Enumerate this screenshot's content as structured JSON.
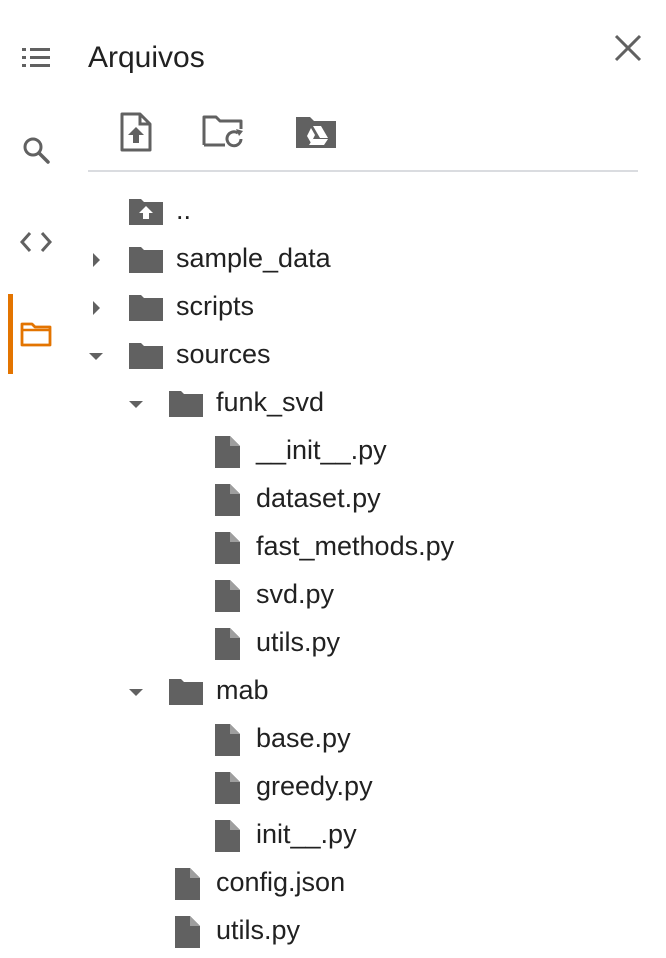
{
  "side_rail": {
    "items": [
      {
        "icon": "table-of-contents-icon"
      },
      {
        "icon": "search-icon"
      },
      {
        "icon": "code-snippets-icon"
      },
      {
        "icon": "folder-icon",
        "active": true
      }
    ],
    "accent_color": "#e37400"
  },
  "panel": {
    "title": "Arquivos",
    "toolbar": [
      {
        "icon": "upload-file-icon"
      },
      {
        "icon": "refresh-folder-icon"
      },
      {
        "icon": "mount-drive-icon"
      }
    ]
  },
  "tree": [
    {
      "label": "..",
      "type": "parent",
      "depth": 0
    },
    {
      "label": "sample_data",
      "type": "folder",
      "depth": 0,
      "expanded": false
    },
    {
      "label": "scripts",
      "type": "folder",
      "depth": 0,
      "expanded": false
    },
    {
      "label": "sources",
      "type": "folder",
      "depth": 0,
      "expanded": true
    },
    {
      "label": "funk_svd",
      "type": "folder",
      "depth": 1,
      "expanded": true
    },
    {
      "label": "__init__.py",
      "type": "file",
      "depth": 2
    },
    {
      "label": "dataset.py",
      "type": "file",
      "depth": 2
    },
    {
      "label": "fast_methods.py",
      "type": "file",
      "depth": 2
    },
    {
      "label": "svd.py",
      "type": "file",
      "depth": 2
    },
    {
      "label": "utils.py",
      "type": "file",
      "depth": 2
    },
    {
      "label": "mab",
      "type": "folder",
      "depth": 1,
      "expanded": true
    },
    {
      "label": "base.py",
      "type": "file",
      "depth": 2
    },
    {
      "label": "greedy.py",
      "type": "file",
      "depth": 2
    },
    {
      "label": "init__.py",
      "type": "file",
      "depth": 2
    },
    {
      "label": "config.json",
      "type": "file",
      "depth": 1
    },
    {
      "label": "utils.py",
      "type": "file",
      "depth": 1
    }
  ]
}
